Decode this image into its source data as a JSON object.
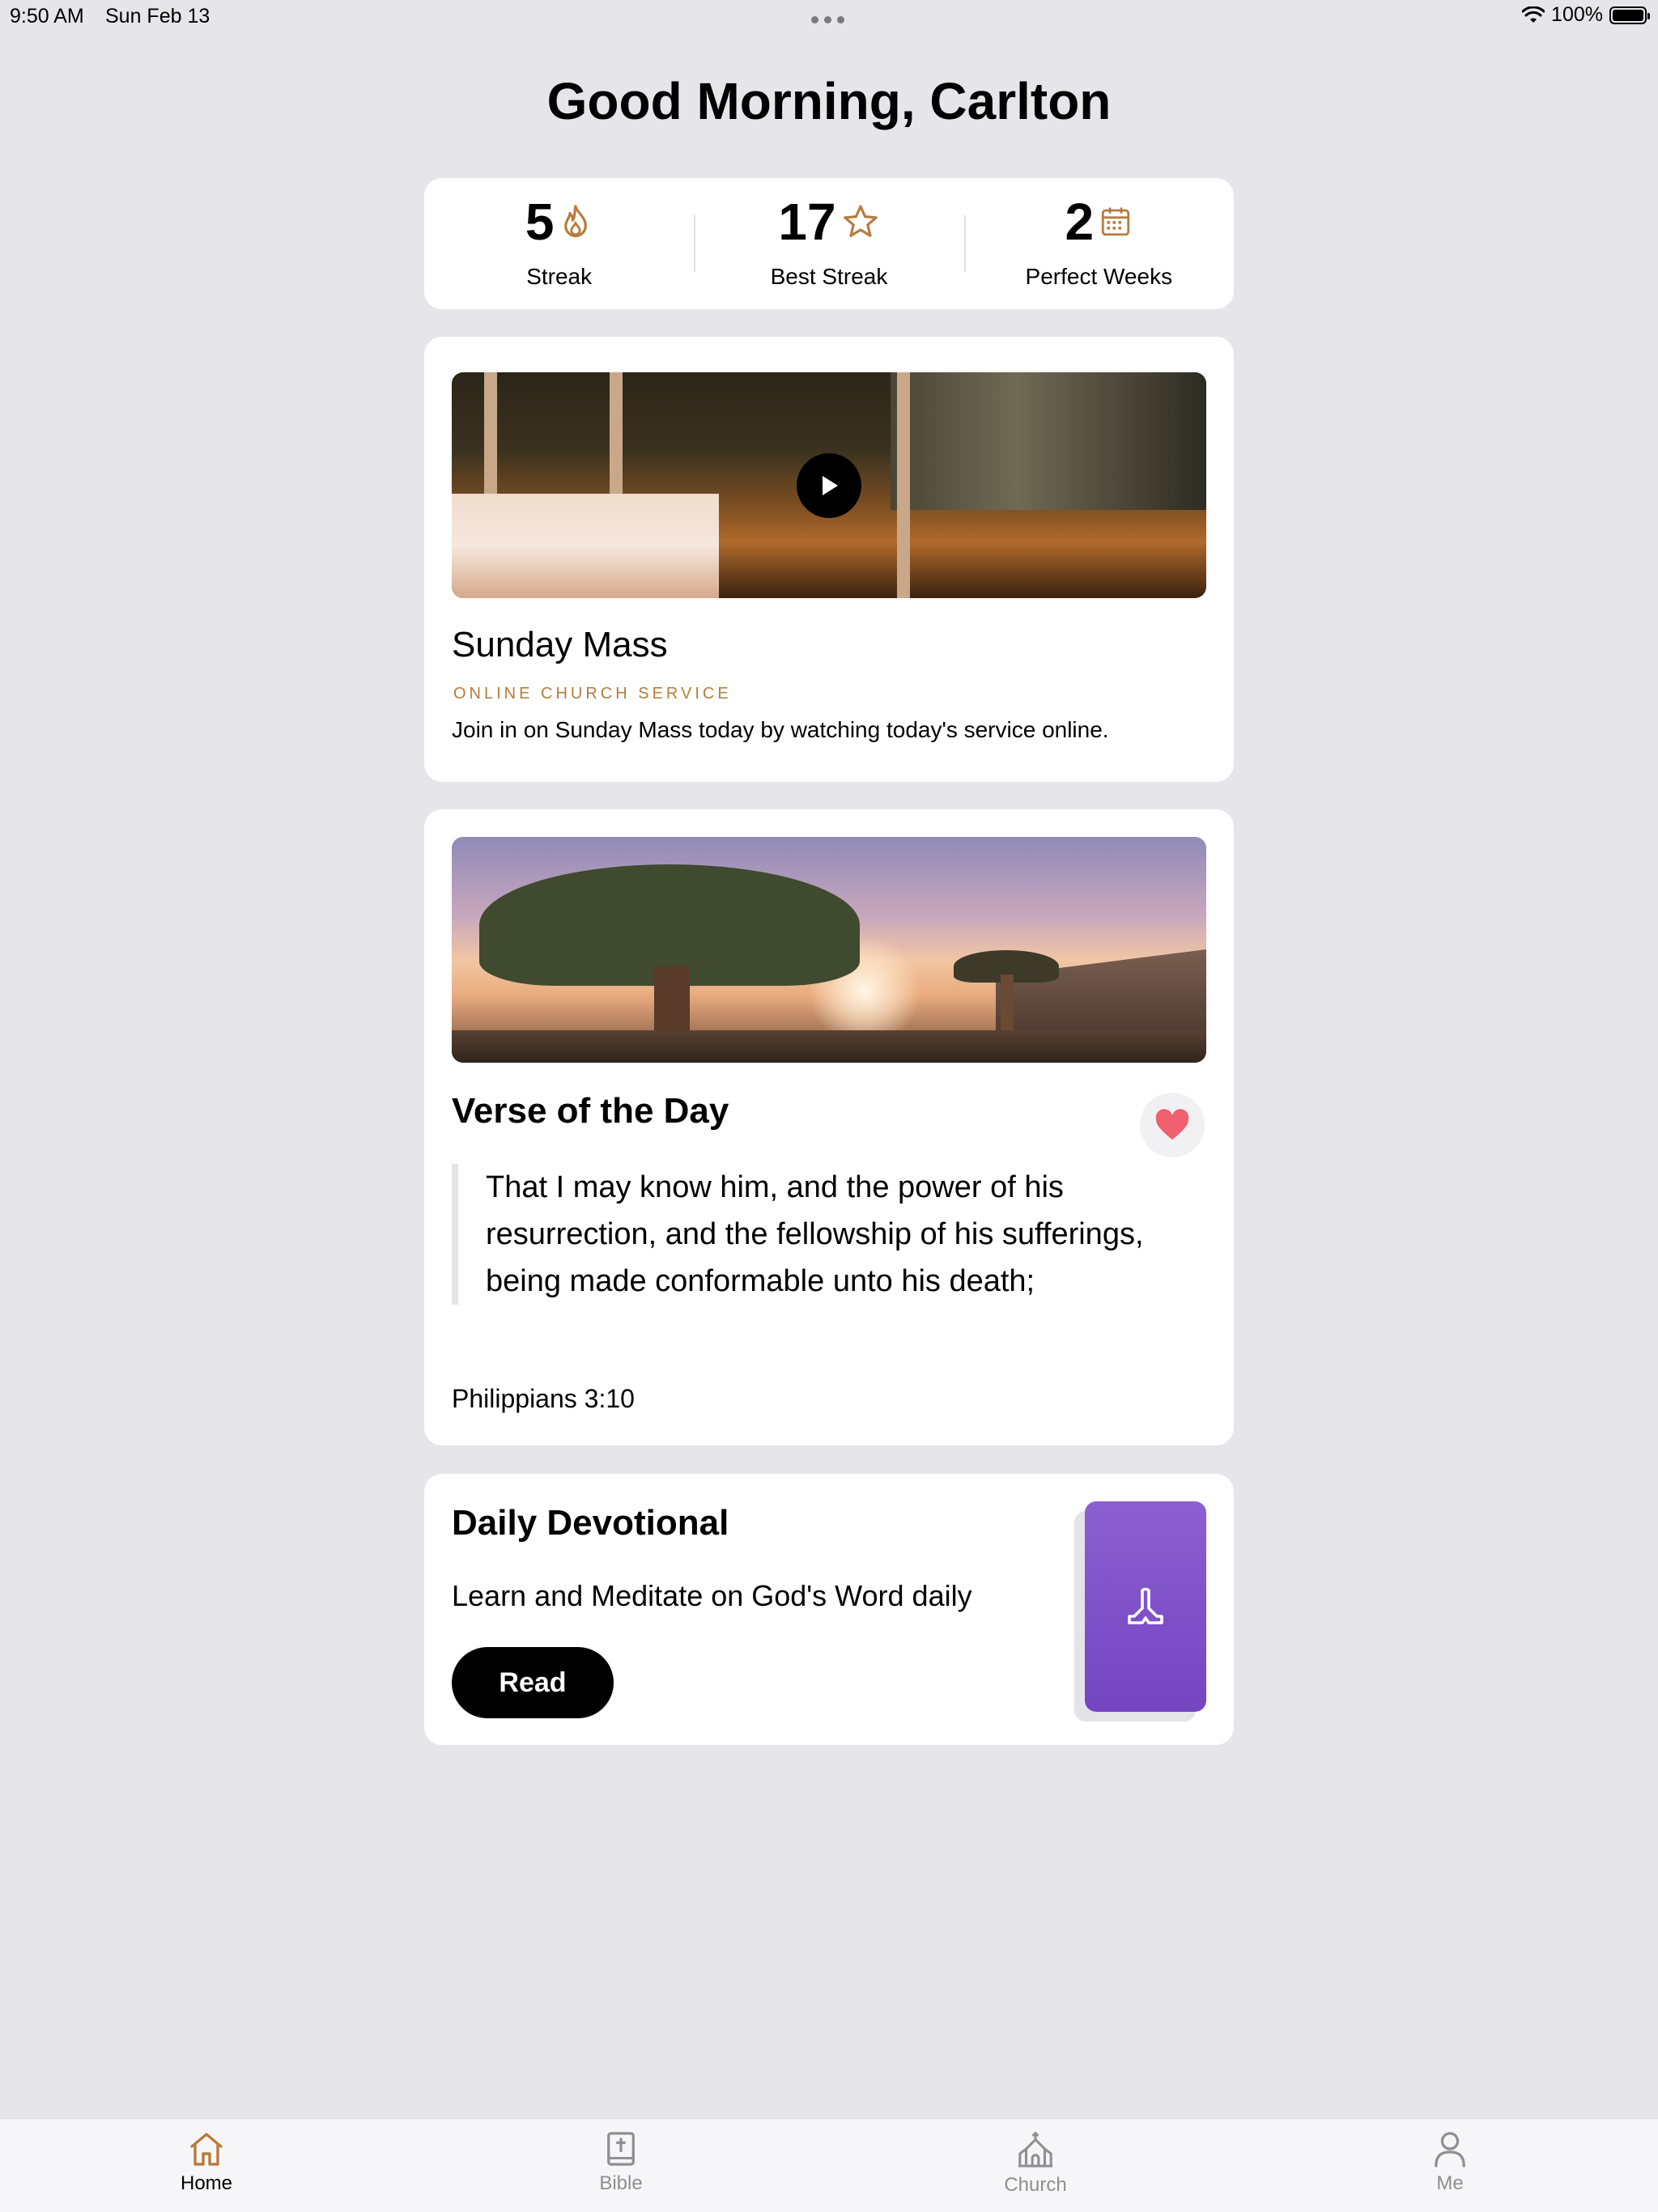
{
  "status_bar": {
    "time": "9:50 AM",
    "date": "Sun Feb 13",
    "battery": "100%"
  },
  "greeting": "Good Morning, Carlton",
  "stats": [
    {
      "value": "5",
      "label": "Streak",
      "icon": "flame-icon"
    },
    {
      "value": "17",
      "label": "Best Streak",
      "icon": "star-icon"
    },
    {
      "value": "2",
      "label": "Perfect Weeks",
      "icon": "calendar-icon"
    }
  ],
  "mass": {
    "title": "Sunday Mass",
    "kicker": "ONLINE CHURCH SERVICE",
    "description": "Join in on Sunday Mass today by watching today's service online."
  },
  "verse": {
    "title": "Verse of the Day",
    "text": "That I may know him, and the power of his resurrection, and the fellowship of his sufferings, being made conformable unto his death;",
    "reference": "Philippians 3:10"
  },
  "devotional": {
    "title": "Daily Devotional",
    "description": "Learn and Meditate on God's Word daily",
    "button": "Read"
  },
  "tabs": [
    {
      "label": "Home",
      "icon": "home-icon",
      "active": true
    },
    {
      "label": "Bible",
      "icon": "bible-icon",
      "active": false
    },
    {
      "label": "Church",
      "icon": "church-icon",
      "active": false
    },
    {
      "label": "Me",
      "icon": "person-icon",
      "active": false
    }
  ],
  "colors": {
    "accent": "#b87b3c",
    "heart": "#f0606e",
    "book": "#7a4bc6",
    "background": "#e6e5ea"
  }
}
